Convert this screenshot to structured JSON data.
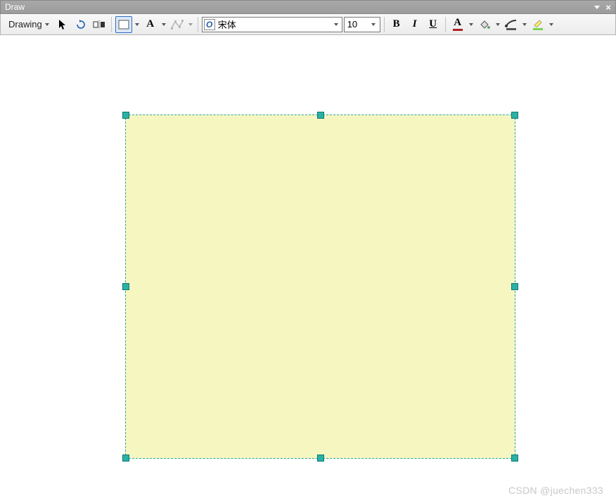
{
  "window": {
    "title": "Draw"
  },
  "toolbar": {
    "drawing_label": "Drawing",
    "font_name": "宋体",
    "font_size": "10",
    "bold": "B",
    "italic": "I",
    "underline": "U",
    "font_color_letter": "A",
    "textbox_letter": "A",
    "colors": {
      "font_underline": "#b02020",
      "extrude_underline": "#7fd34f",
      "highlight_underline": "#7fd34f"
    }
  },
  "shape": {
    "fill": "#f6f6c0",
    "selection_color": "#2aa6a6"
  },
  "watermark": "CSDN @juechen333"
}
